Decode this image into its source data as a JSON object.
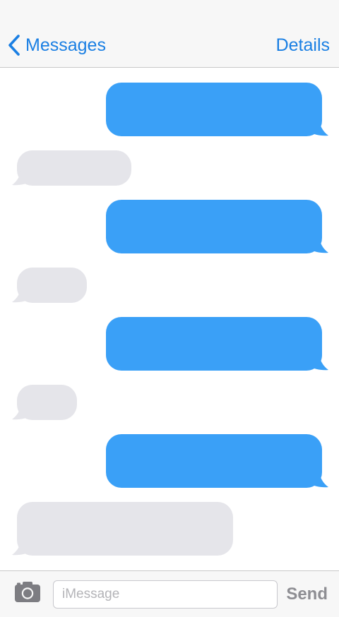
{
  "header": {
    "back_label": "Messages",
    "details_label": "Details"
  },
  "thread": {
    "messages": [
      {
        "direction": "outgoing",
        "text": ""
      },
      {
        "direction": "incoming",
        "text": ""
      },
      {
        "direction": "outgoing",
        "text": ""
      },
      {
        "direction": "incoming",
        "text": ""
      },
      {
        "direction": "outgoing",
        "text": ""
      },
      {
        "direction": "incoming",
        "text": ""
      },
      {
        "direction": "outgoing",
        "text": ""
      },
      {
        "direction": "incoming",
        "text": ""
      }
    ]
  },
  "composer": {
    "placeholder": "iMessage",
    "value": "",
    "send_label": "Send",
    "camera_icon": "camera-icon"
  },
  "colors": {
    "accent": "#1a7fe3",
    "outgoing_bubble": "#3aa0f7",
    "incoming_bubble": "#e5e5ea",
    "send_disabled": "#8e8e93"
  }
}
